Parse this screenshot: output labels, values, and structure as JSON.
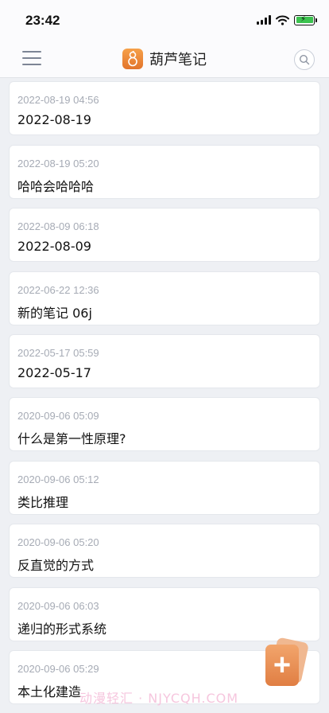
{
  "status_bar": {
    "time": "23:42"
  },
  "header": {
    "app_title": "葫芦笔记"
  },
  "notes": [
    {
      "time": "2022-08-19 04:56",
      "title": "2022-08-19"
    },
    {
      "time": "2022-08-19 05:20",
      "title": "哈哈会哈哈哈"
    },
    {
      "time": "2022-08-09 06:18",
      "title": "2022-08-09"
    },
    {
      "time": "2022-06-22 12:36",
      "title": "新的笔记 06j"
    },
    {
      "time": "2022-05-17 05:59",
      "title": "2022-05-17"
    },
    {
      "time": "2020-09-06 05:09",
      "title": "什么是第一性原理?"
    },
    {
      "time": "2020-09-06 05:12",
      "title": "类比推理"
    },
    {
      "time": "2020-09-06 05:20",
      "title": "反直觉的方式"
    },
    {
      "time": "2020-09-06 06:03",
      "title": "递归的形式系统"
    },
    {
      "time": "2020-09-06 05:29",
      "title": "本土化建造"
    }
  ],
  "fab": {
    "label": "+"
  },
  "watermark": "动漫轻汇 · NJYCQH.COM",
  "colors": {
    "accent": "#e8884a",
    "background": "#eef0f4",
    "card": "#ffffff",
    "timestamp": "#a6abb5"
  },
  "icons": {
    "menu": "hamburger-icon",
    "search": "search-icon",
    "logo": "gourd-logo-icon",
    "add": "plus-icon"
  }
}
